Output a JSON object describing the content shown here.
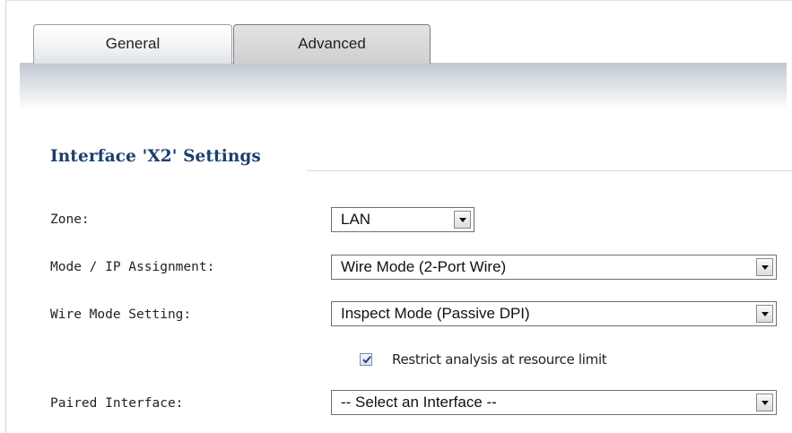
{
  "tabs": [
    {
      "label": "General",
      "active": true
    },
    {
      "label": "Advanced",
      "active": false
    }
  ],
  "section": {
    "title": "Interface 'X2' Settings"
  },
  "fields": {
    "zone": {
      "label": "Zone:",
      "value": "LAN"
    },
    "mode": {
      "label": "Mode / IP Assignment:",
      "value": "Wire Mode (2-Port Wire)"
    },
    "wire_mode": {
      "label": "Wire Mode Setting:",
      "value": "Inspect Mode (Passive DPI)"
    },
    "restrict": {
      "label": "Restrict analysis at resource limit",
      "checked": true
    },
    "paired": {
      "label": "Paired Interface:",
      "value": "-- Select an Interface --"
    }
  },
  "colors": {
    "section_title": "#1b3f6e",
    "checkmark": "#2a3f8f"
  }
}
